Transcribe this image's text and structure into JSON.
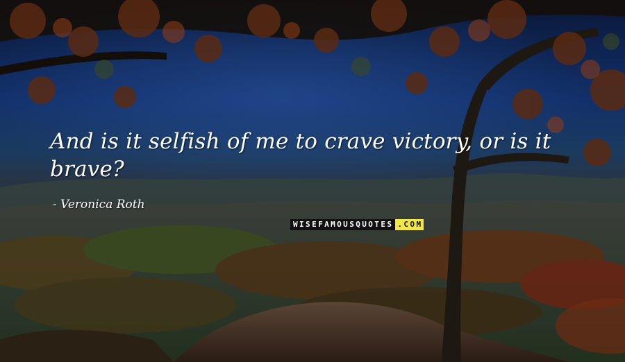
{
  "quote": {
    "text": "And is it selfish of me to crave victory, or is it brave?"
  },
  "author": {
    "prefix": "- ",
    "name": "Veronica Roth"
  },
  "watermark": {
    "main": "WISEFAMOUSQUOTES",
    "suffix": ".COM"
  },
  "colors": {
    "text": "#ffffff",
    "watermark_bg": "#111111",
    "watermark_accent": "#f2e64a"
  }
}
